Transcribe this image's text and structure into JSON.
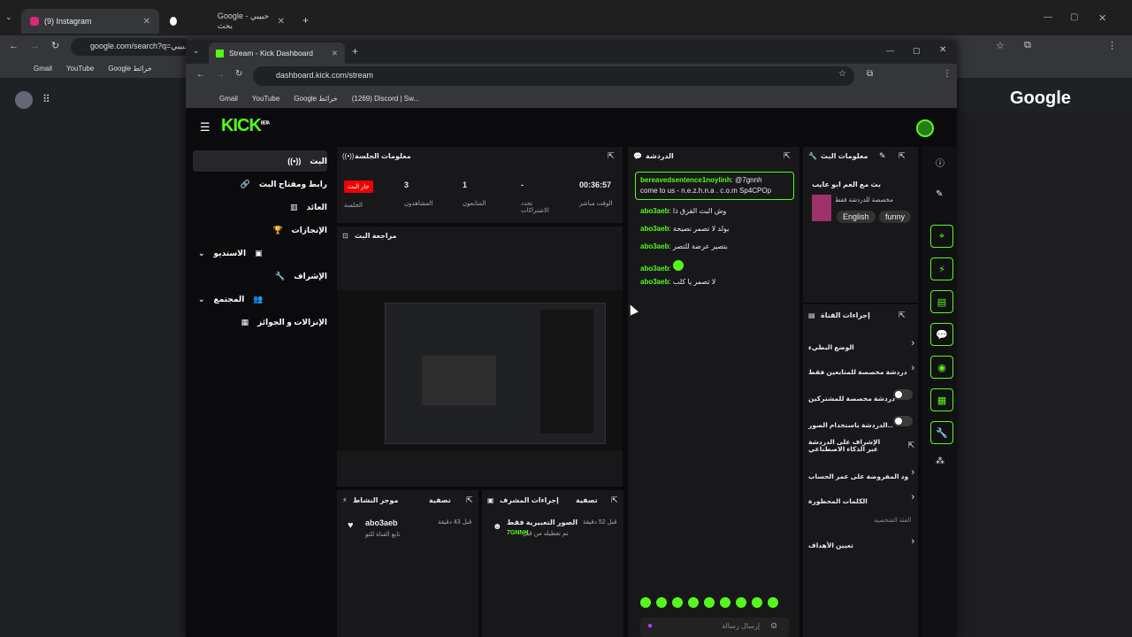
{
  "outer_browser": {
    "tabs": [
      {
        "title": "(9) Instagram",
        "icon": "instagram-icon"
      },
      {
        "title": "Google - حبيبي بحث",
        "icon": "google-icon"
      }
    ],
    "url": "google.com/search?q=حبيبي",
    "bookmarks": [
      "Gmail",
      "YouTube",
      "Google خرائط"
    ],
    "google_logo": "Google"
  },
  "inner_browser": {
    "tab_title": "Stream - Kick Dashboard",
    "url": "dashboard.kick.com/stream",
    "bookmarks": [
      "Gmail",
      "YouTube",
      "Google خرائط",
      "(1269) Discord | Sw..."
    ]
  },
  "kick": {
    "logo": "KICK",
    "logo_beta": "BETA",
    "nav": [
      {
        "label": "البث",
        "icon": "broadcast-icon"
      },
      {
        "label": "رابط ومفتاح البث",
        "icon": "link-icon"
      },
      {
        "label": "العائد",
        "icon": "chart-icon"
      },
      {
        "label": "الإنجازات",
        "icon": "trophy-icon"
      },
      {
        "label": "الاستديو",
        "icon": "studio-icon"
      },
      {
        "label": "الإشراف",
        "icon": "wrench-icon"
      },
      {
        "label": "المجتمع",
        "icon": "community-icon"
      },
      {
        "label": "الإنزالات و الجوائز",
        "icon": "drops-icon"
      }
    ],
    "session": {
      "title": "معلومات الجلسة",
      "live_badge": "جار البث",
      "live_label": "الجلسة",
      "viewers_value": "3",
      "viewers_label": "المشاهدون",
      "followers_value": "1",
      "followers_label": "المتابعون",
      "subs_value": "-",
      "subs_label": "تحدد الاشتراكات",
      "uptime_value": "00:36:57",
      "uptime_label": "الوقت مباشر"
    },
    "preview_title": "مراجعة البث",
    "activity": {
      "title": "موجز النشاط",
      "filter": "تصفية",
      "user": "abo3aeb",
      "time": "قبل 43 دقيقة",
      "action": "تابع القناة للتو"
    },
    "mod_actions": {
      "title": "إجراءات المشرف",
      "filter": "تصفية",
      "time": "قبل 52 دقيقة",
      "action": "الصور التعبيرية فقط",
      "detail": "تم تعطيله من قبل",
      "user": "7GNNH"
    },
    "chat": {
      "title": "الدردشة",
      "pinned_user": "bereavedsentence1noylinh",
      "pinned_text": ": @7gnnh",
      "pinned_line2": "come to us - n.e.z.h.n.a . c.o.m Sp4CPOp",
      "messages": [
        {
          "user": "abo3aeb",
          "text": "وش البث القزق ذا"
        },
        {
          "user": "abo3aeb",
          "text": "يولد لا تصمر نصيحة"
        },
        {
          "user": "abo3aeb",
          "text": "بتصير عرضة للتصر"
        },
        {
          "user": "abo3aeb",
          "text": ""
        },
        {
          "user": "abo3aeb",
          "text": "لا تصمر يا كلب"
        }
      ],
      "input_placeholder": "إرسال رسالة"
    },
    "stream_info": {
      "title": "معلومات البث",
      "stream_title": "بث مع العم ابو عايب",
      "category": "مخصصة للدردشة فقط",
      "tags": [
        "English",
        "funny"
      ]
    },
    "channel_actions": {
      "title": "إجراءات القناة",
      "items": [
        {
          "label": "الوضع البطيء",
          "control": "chevron"
        },
        {
          "label": "دردشة مخصصة للمتابعين فقط",
          "control": "chevron"
        },
        {
          "label": "دردشة مخصصة للمشتركين",
          "control": "toggle"
        },
        {
          "label": "الدردشة باستخدام الصور...",
          "control": "toggle"
        },
        {
          "label": "الإشراف على الدردشة عبر الذكاء الاصطناعي",
          "control": "external"
        },
        {
          "label": "ود المفروضة على عمر الحساب",
          "control": "chevron"
        },
        {
          "label": "الكلمات المحظورة",
          "control": "chevron"
        },
        {
          "label": "الفئة الشخصية",
          "control": "none"
        },
        {
          "label": "تعيين الأهداف",
          "control": "chevron"
        }
      ]
    }
  }
}
